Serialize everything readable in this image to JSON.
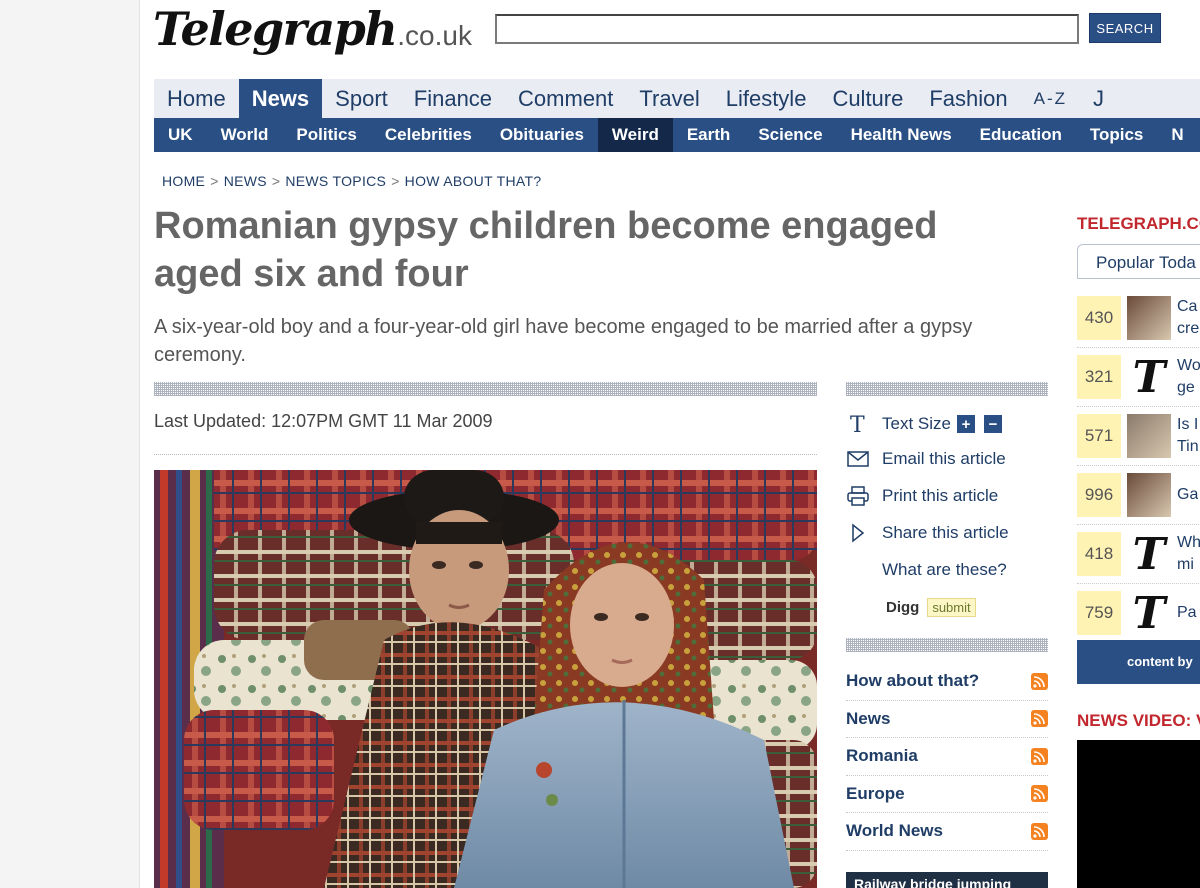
{
  "header": {
    "logo_brand": "Telegraph",
    "logo_tld": ".co.uk",
    "search_value": "",
    "search_button": "SEARCH"
  },
  "main_nav": [
    {
      "label": "Home",
      "active": false
    },
    {
      "label": "News",
      "active": true
    },
    {
      "label": "Sport",
      "active": false
    },
    {
      "label": "Finance",
      "active": false
    },
    {
      "label": "Comment",
      "active": false
    },
    {
      "label": "Travel",
      "active": false
    },
    {
      "label": "Lifestyle",
      "active": false
    },
    {
      "label": "Culture",
      "active": false
    },
    {
      "label": "Fashion",
      "active": false
    },
    {
      "label": "A-Z",
      "active": false
    },
    {
      "label": "J",
      "active": false
    }
  ],
  "sub_nav": [
    {
      "label": "UK",
      "active": false
    },
    {
      "label": "World",
      "active": false
    },
    {
      "label": "Politics",
      "active": false
    },
    {
      "label": "Celebrities",
      "active": false
    },
    {
      "label": "Obituaries",
      "active": false
    },
    {
      "label": "Weird",
      "active": true
    },
    {
      "label": "Earth",
      "active": false
    },
    {
      "label": "Science",
      "active": false
    },
    {
      "label": "Health News",
      "active": false
    },
    {
      "label": "Education",
      "active": false
    },
    {
      "label": "Topics",
      "active": false
    },
    {
      "label": "N",
      "active": false
    }
  ],
  "breadcrumb": [
    "HOME",
    "NEWS",
    "NEWS TOPICS",
    "HOW ABOUT THAT?"
  ],
  "article": {
    "headline": "Romanian gypsy children become engaged aged six and four",
    "standfirst": "A six-year-old boy and a four-year-old girl have become engaged to be married after a gypsy ceremony.",
    "last_updated": "Last Updated: 12:07PM GMT 11 Mar 2009"
  },
  "tools": {
    "text_size": "Text Size",
    "text_size_plus": "+",
    "text_size_minus": "−",
    "email": "Email this article",
    "print": "Print this article",
    "share": "Share this article",
    "what": "What are these?",
    "digg": "Digg",
    "digg_submit": "submit"
  },
  "topics": [
    "How about that?",
    "News",
    "Romania",
    "Europe",
    "World News"
  ],
  "promo": "Railway bridge jumping",
  "right_column": {
    "title": "TELEGRAPH.CO",
    "tab": "Popular Toda",
    "popular": [
      {
        "count": "430",
        "text1": "Ca",
        "text2": "cre",
        "thumb": "photo"
      },
      {
        "count": "321",
        "text1": "Wo",
        "text2": "ge",
        "thumb": "logo"
      },
      {
        "count": "571",
        "text1": "Is I",
        "text2": "Tin",
        "thumb": "photo"
      },
      {
        "count": "996",
        "text1": "Ga",
        "text2": "",
        "thumb": "photo"
      },
      {
        "count": "418",
        "text1": "Wh",
        "text2": "mi",
        "thumb": "logo"
      },
      {
        "count": "759",
        "text1": "Pa",
        "text2": "",
        "thumb": "logo"
      }
    ],
    "content_by": "content by",
    "news_video": "NEWS VIDEO: V"
  },
  "icons": {
    "text_size": "T-icon",
    "email": "envelope-icon",
    "print": "printer-icon",
    "share": "share-arrow-icon",
    "rss": "rss-icon"
  },
  "colors": {
    "brand_blue": "#2a4f84",
    "nav_bg": "#e9edf3",
    "accent_red": "#c1272d",
    "rss_orange": "#f58220"
  }
}
